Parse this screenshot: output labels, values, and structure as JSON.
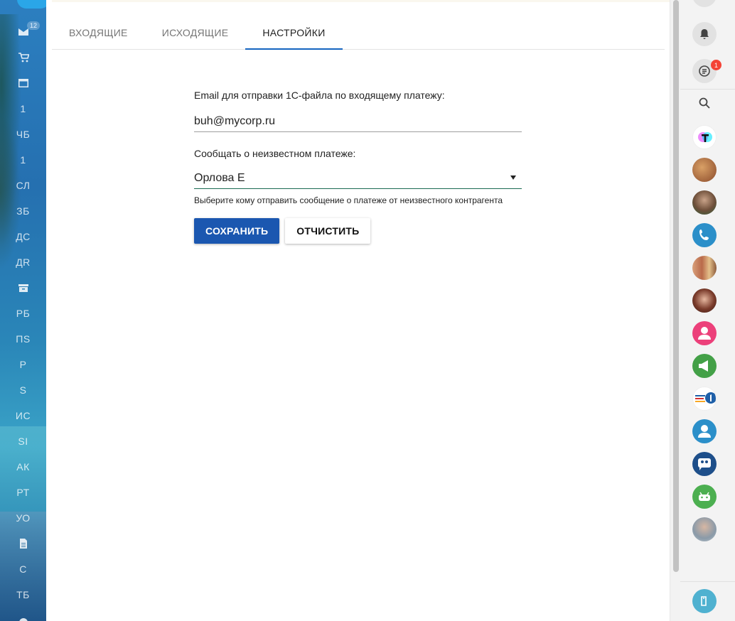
{
  "sidebar": {
    "mail_badge": "12",
    "items": [
      {
        "icon": "mail-icon"
      },
      {
        "icon": "cart-icon"
      },
      {
        "icon": "window-icon"
      },
      {
        "label": "1"
      },
      {
        "label": "ЧБ"
      },
      {
        "label": "1"
      },
      {
        "label": "СЛ"
      },
      {
        "label": "ЗБ"
      },
      {
        "label": "ДС"
      },
      {
        "label": "ДR"
      },
      {
        "icon": "archive-icon"
      },
      {
        "label": "РБ"
      },
      {
        "label": "ПS"
      },
      {
        "label": "Р"
      },
      {
        "label": "S"
      },
      {
        "label": "ИС"
      },
      {
        "label": "SI"
      },
      {
        "label": "АК"
      },
      {
        "label": "РТ"
      },
      {
        "label": "УО"
      },
      {
        "icon": "document-icon"
      },
      {
        "label": "С"
      },
      {
        "label": "ТБ"
      }
    ]
  },
  "tabs": [
    {
      "label": "ВХОДЯЩИЕ",
      "active": false
    },
    {
      "label": "ИСХОДЯЩИЕ",
      "active": false
    },
    {
      "label": "НАСТРОЙКИ",
      "active": true
    }
  ],
  "form": {
    "email_label": "Email для отправки 1С-файла по входящему платежу:",
    "email_value": "buh@mycorp.ru",
    "notify_label": "Сообщать о неизвестном платеже:",
    "notify_value": "Орлова Е",
    "notify_hint": "Выберите кому отправить сообщение о платеже от неизвестного контрагента",
    "save_label": "СОХРАНИТЬ",
    "clear_label": "ОТЧИСТИТЬ"
  },
  "right_bar": {
    "chat_badge": "1",
    "colors": {
      "primary": "#1b57b0",
      "tab_indicator": "#1565c0",
      "badge": "#f44336"
    }
  }
}
